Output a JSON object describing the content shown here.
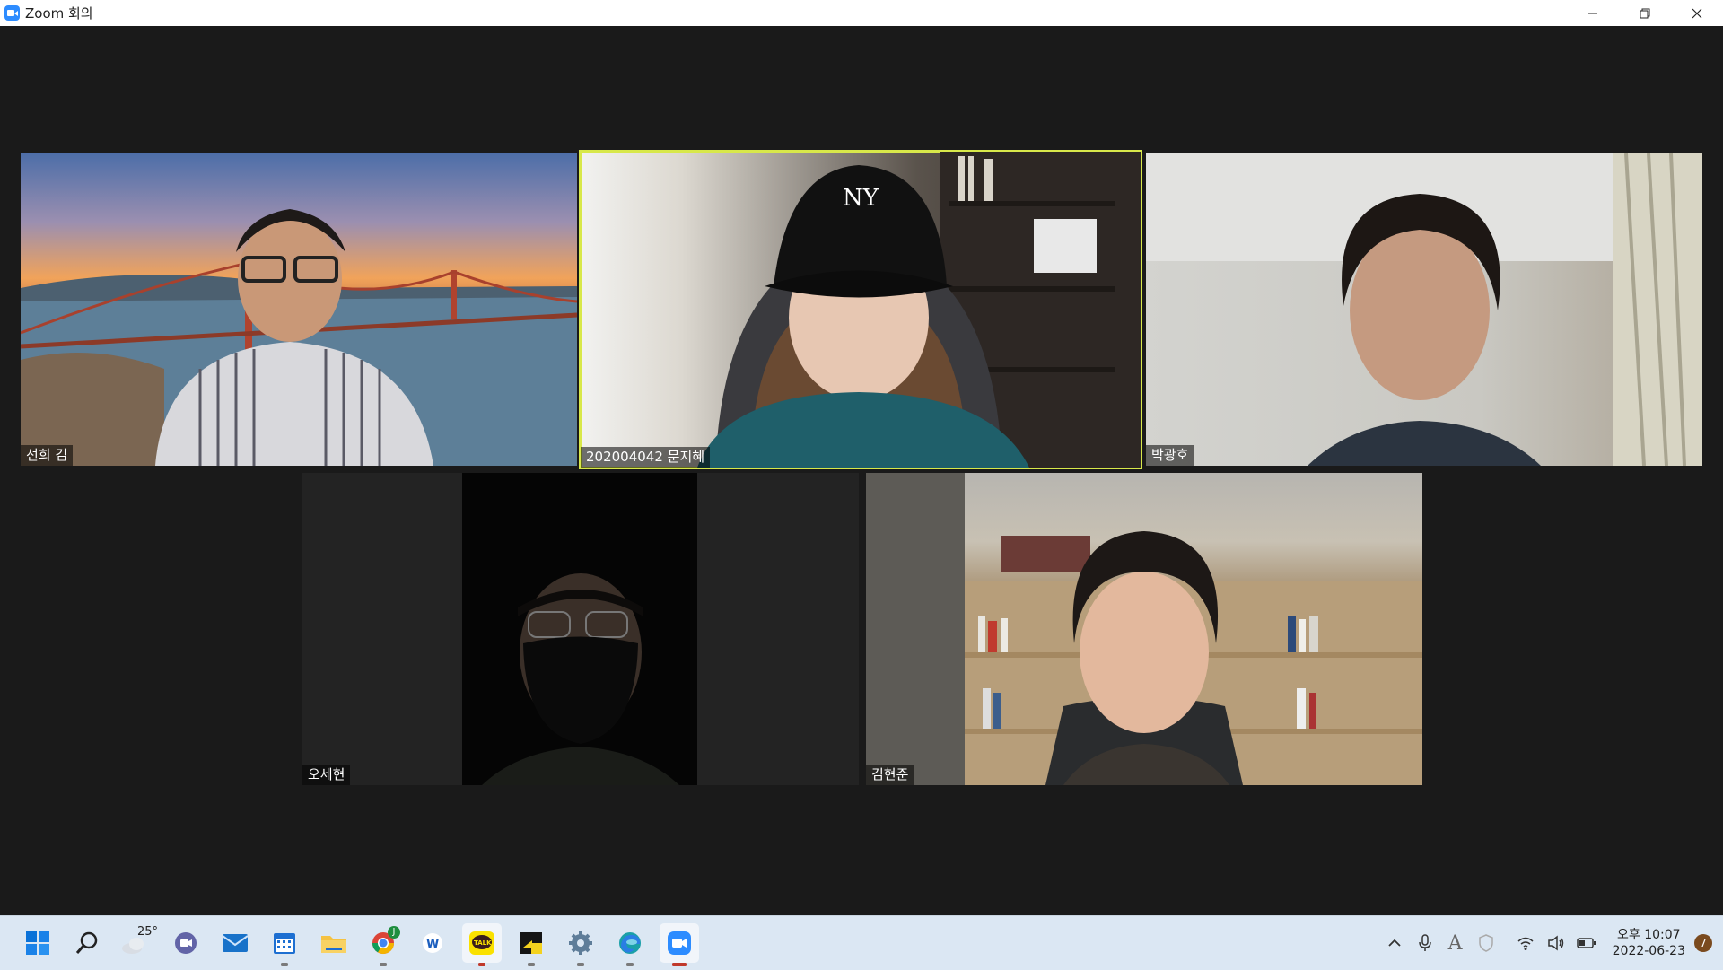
{
  "window": {
    "title": "Zoom 회의",
    "controls": {
      "minimize": "minimize",
      "restore": "restore",
      "close": "close"
    }
  },
  "participants": [
    {
      "name": "선희 김"
    },
    {
      "name": "202004042 문지혜",
      "active_speaker": true
    },
    {
      "name": "박광호"
    },
    {
      "name": "오세현"
    },
    {
      "name": "김현준"
    }
  ],
  "colors": {
    "active_border": "#d8e84a",
    "titlebar": "#ffffff",
    "meeting_bg": "#1a1a1a",
    "taskbar": "#dbe7f3"
  },
  "taskbar": {
    "apps": [
      {
        "icon": "windows-start-icon"
      },
      {
        "icon": "search-icon"
      },
      {
        "icon": "weather-icon",
        "label": "25°"
      },
      {
        "icon": "teams-chat-icon"
      },
      {
        "icon": "mail-icon"
      },
      {
        "icon": "calendar-icon"
      },
      {
        "icon": "file-explorer-icon"
      },
      {
        "icon": "chrome-icon",
        "badge": "J"
      },
      {
        "icon": "word-icon"
      },
      {
        "icon": "kakaotalk-icon",
        "label": "TALK"
      },
      {
        "icon": "sticky-notes-icon"
      },
      {
        "icon": "settings-icon"
      },
      {
        "icon": "edge-icon"
      },
      {
        "icon": "zoom-icon"
      }
    ],
    "tray": {
      "clock_time": "오후 10:07",
      "clock_date": "2022-06-23",
      "notification_count": "7",
      "input_indicator": "A"
    }
  }
}
